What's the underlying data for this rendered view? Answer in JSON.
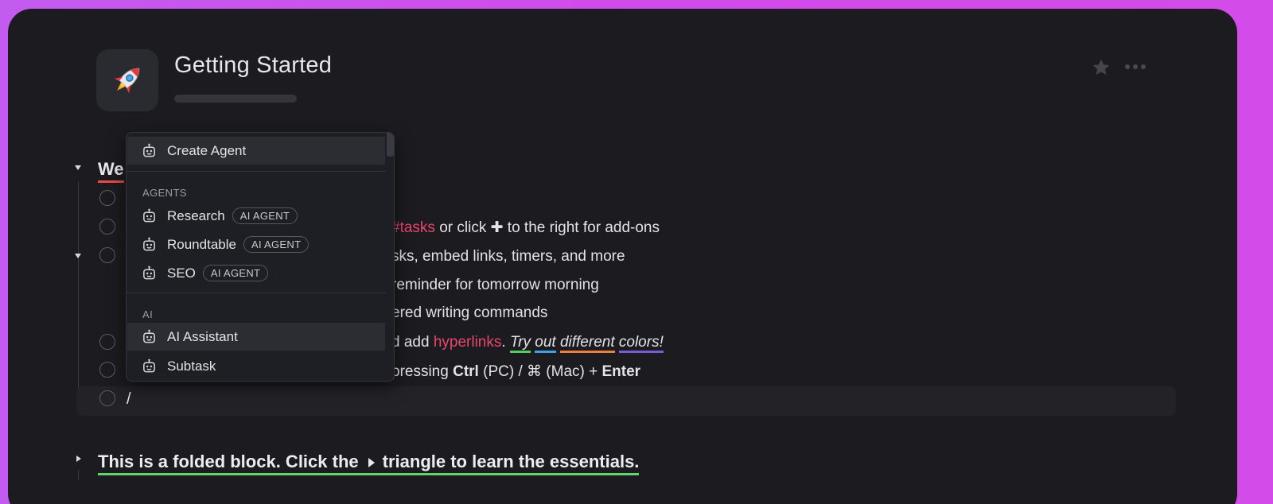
{
  "page": {
    "title": "Getting Started",
    "icon": "rocket-icon"
  },
  "header_actions": {
    "favorite_icon": "star-icon",
    "more_icon": "more-horizontal-icon"
  },
  "block": {
    "heading_visible": "We",
    "lines": [
      {
        "tag": "#tasks",
        "text_a": " or click ",
        "plus": "✚",
        "text_b": " to the right for add-ons"
      },
      {
        "text": "sks, embed links, timers, and more"
      },
      {
        "text": "reminder for tomorrow morning"
      },
      {
        "text": "ered writing commands"
      },
      {
        "text_a": "d add ",
        "link": "hyperlinks",
        "text_b": ". ",
        "styled_1": "Try",
        "styled_2": "out",
        "styled_3": "different",
        "styled_4": "colors!"
      },
      {
        "text_a": "pressing ",
        "key_1": "Ctrl",
        "text_b": " (PC) / ⌘ (Mac) + ",
        "key_2": "Enter"
      }
    ],
    "input_value": "/"
  },
  "folded_block": {
    "text_before": "This is a folded block. Click the",
    "text_after": "triangle to learn the essentials."
  },
  "slash_menu": {
    "create_label": "Create Agent",
    "agents_section": "AGENTS",
    "agents": [
      {
        "label": "Research",
        "badge": "AI AGENT"
      },
      {
        "label": "Roundtable",
        "badge": "AI AGENT"
      },
      {
        "label": "SEO",
        "badge": "AI AGENT"
      }
    ],
    "ai_section": "AI",
    "ai_items": [
      {
        "label": "AI Assistant"
      },
      {
        "label": "Subtask"
      }
    ],
    "item_icon": "robot-icon"
  },
  "colors": {
    "heading_underline": "#e64a4a",
    "tag_link": "#e9466e",
    "folded_underline": "#63d46b",
    "underline_green": "#51d15b",
    "underline_blue": "#3aa5e6",
    "underline_orange": "#ef7d3b",
    "underline_purple": "#7b5ad9"
  }
}
